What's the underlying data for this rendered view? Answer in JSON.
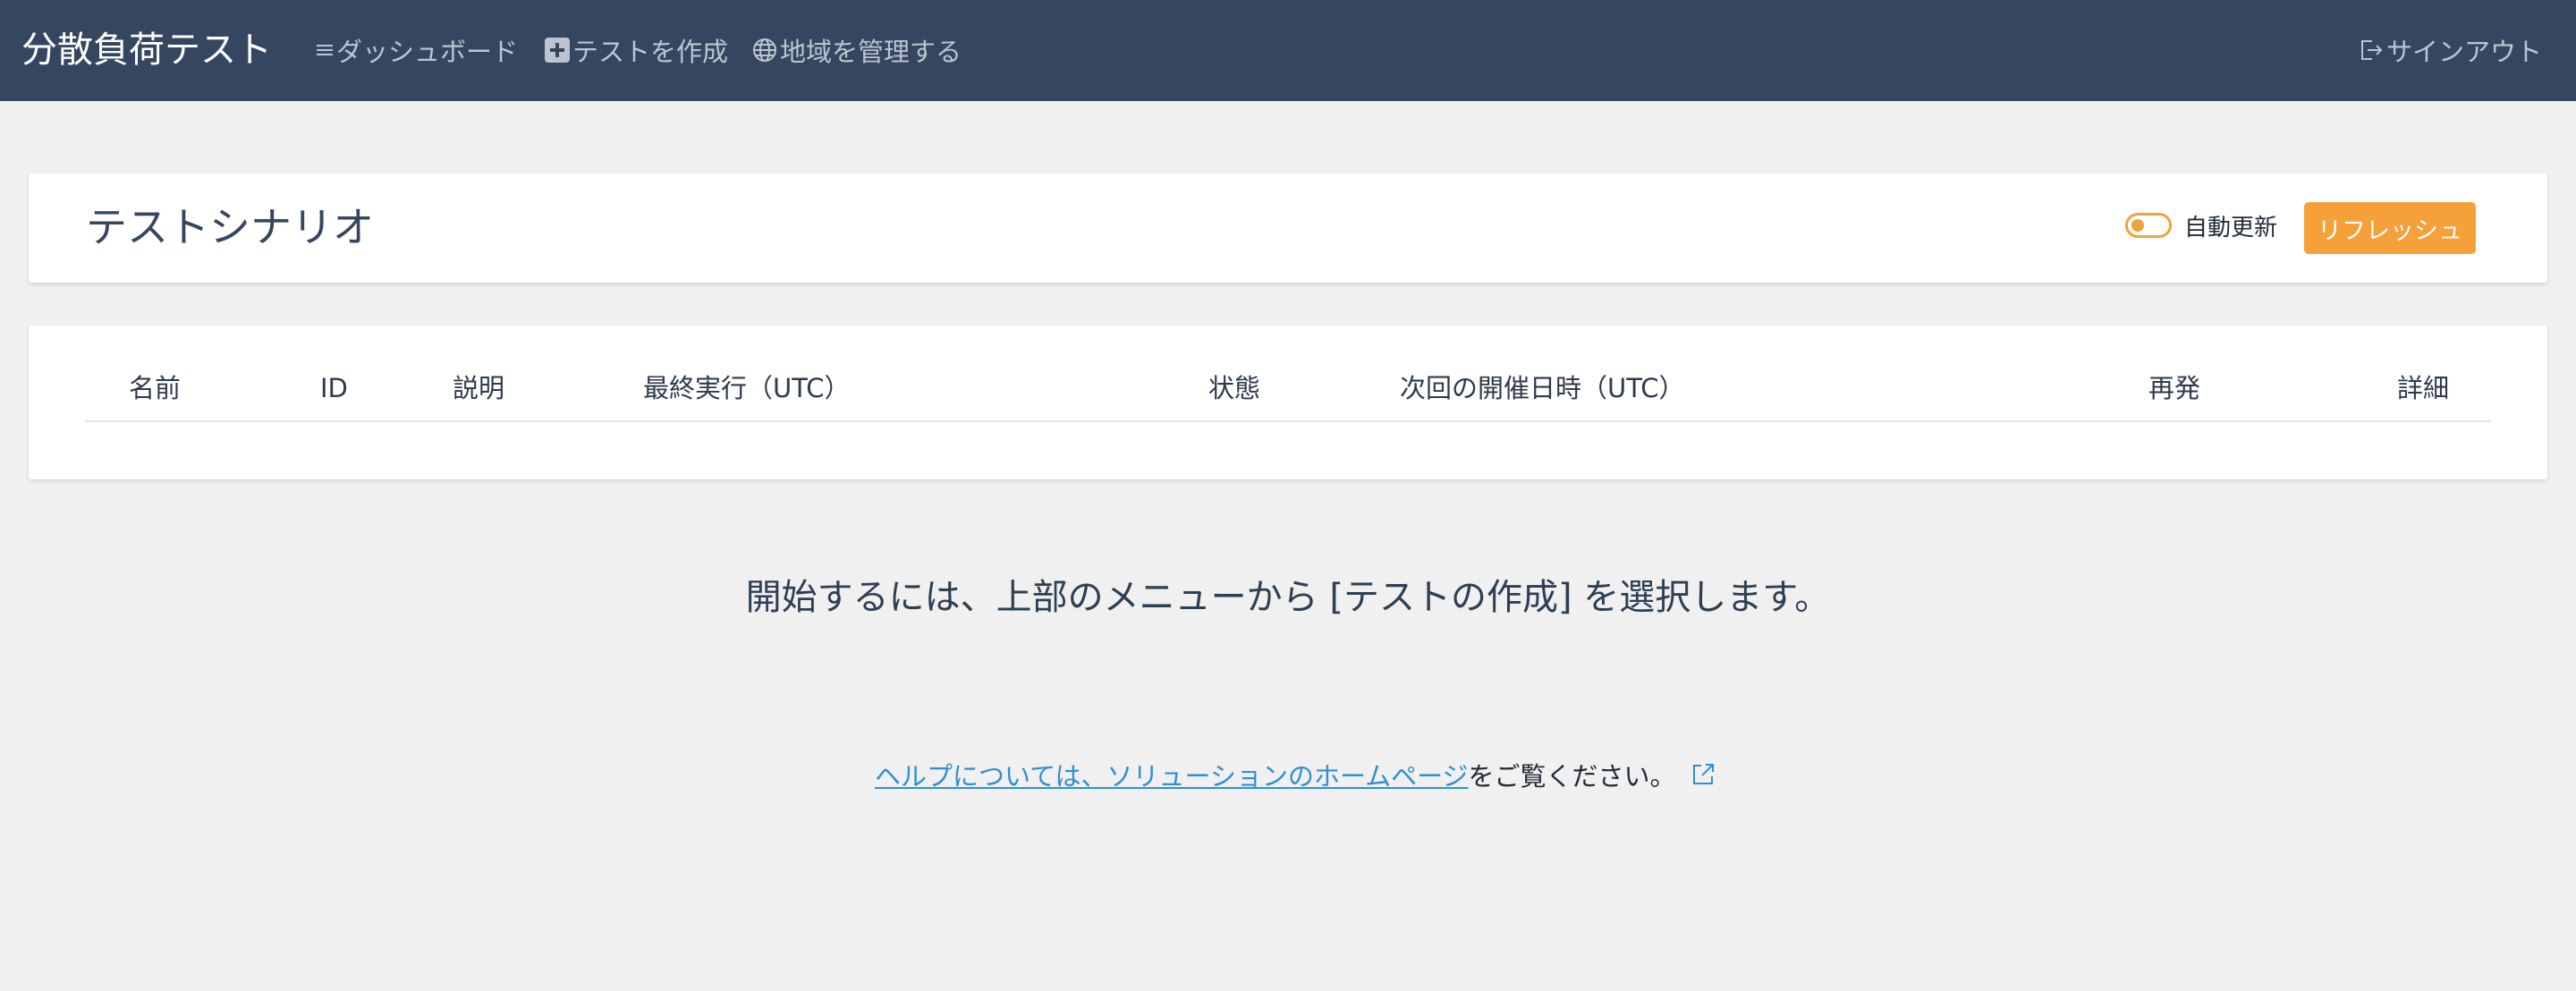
{
  "navbar": {
    "brand": "分散負荷テスト",
    "links": [
      {
        "label": "ダッシュボード",
        "icon": "menu-icon"
      },
      {
        "label": "テストを作成",
        "icon": "plus-square-icon"
      },
      {
        "label": "地域を管理する",
        "icon": "globe-icon"
      }
    ],
    "signout": {
      "label": "サインアウト",
      "icon": "sign-out-icon"
    }
  },
  "header": {
    "title": "テストシナリオ",
    "auto_refresh_label": "自動更新",
    "auto_refresh_on": false,
    "refresh_label": "リフレッシュ"
  },
  "table": {
    "columns": [
      "名前",
      "ID",
      "説明",
      "最終実行（UTC）",
      "状態",
      "次回の開催日時（UTC）",
      "再発",
      "詳細"
    ],
    "rows": []
  },
  "empty_message": "開始するには、上部のメニューから [テストの作成] を選択します。",
  "help": {
    "link_text": "ヘルプについては、ソリューションのホームページ",
    "suffix": "をご覧ください。",
    "icon": "external-link-icon"
  },
  "colors": {
    "navbar_bg": "#354760",
    "accent": "#f6a03a",
    "link": "#2f8fd6",
    "page_bg": "#f0f0f0"
  }
}
